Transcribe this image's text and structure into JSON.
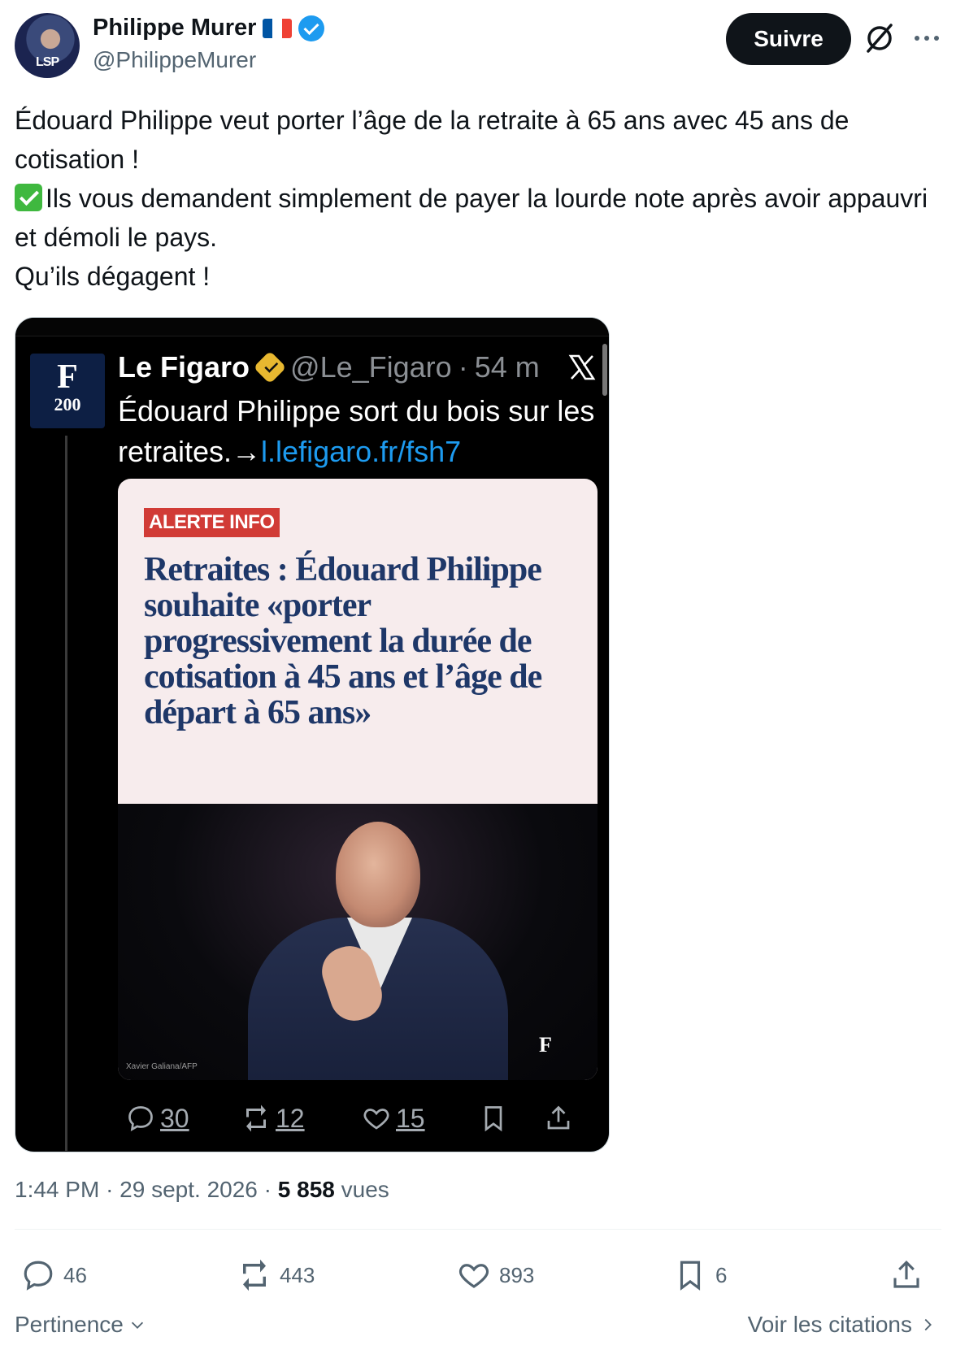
{
  "author": {
    "name": "Philippe Murer",
    "handle": "@PhilippeMurer",
    "avatar_tag": "LSP",
    "flag_colors": [
      "#0055a4",
      "#ffffff",
      "#ef4135"
    ],
    "verified_color": "#1d9bf0"
  },
  "header": {
    "follow_label": "Suivre"
  },
  "tweet": {
    "line1": "Édouard Philippe veut porter l’âge de la retraite à 65 ans avec 45 ans de cotisation !",
    "line2": "Ils vous demandent simplement de payer la lourde note après avoir appauvri et démoli le pays.",
    "line3": "Qu’ils dégagent !"
  },
  "embedded": {
    "name": "Le Figaro",
    "handle": "@Le_Figaro",
    "sep": "·",
    "time": "54 m",
    "logo_letter": "F",
    "logo_year": "200",
    "text": "Édouard Philippe sort du bois sur les retraites.→",
    "link": "l.lefigaro.fr/fsh7",
    "card": {
      "badge": "ALERTE INFO",
      "headline": "Retraites : Édouard Philippe souhaite «porter progressivement la durée de cotisation à 45 ans et l’âge de départ à 65 ans»",
      "photo_credit": "Xavier Galiana/AFP",
      "watermark": "F"
    },
    "stats": {
      "replies": "30",
      "reposts": "12",
      "likes": "15"
    }
  },
  "meta": {
    "time": "1:44 PM",
    "date": "29 sept. 2026",
    "views_count": "5 858",
    "views_label": "vues",
    "sep": "·"
  },
  "actions": {
    "replies": "46",
    "reposts": "443",
    "likes": "893",
    "bookmarks": "6"
  },
  "footer": {
    "sort_label": "Pertinence",
    "quotes_label": "Voir les citations"
  },
  "icons": [
    "grok-icon",
    "more-icon",
    "reply-icon",
    "repost-icon",
    "like-icon",
    "bookmark-icon",
    "share-icon",
    "x-logo-icon",
    "chevron-down-icon",
    "chevron-right-icon"
  ]
}
